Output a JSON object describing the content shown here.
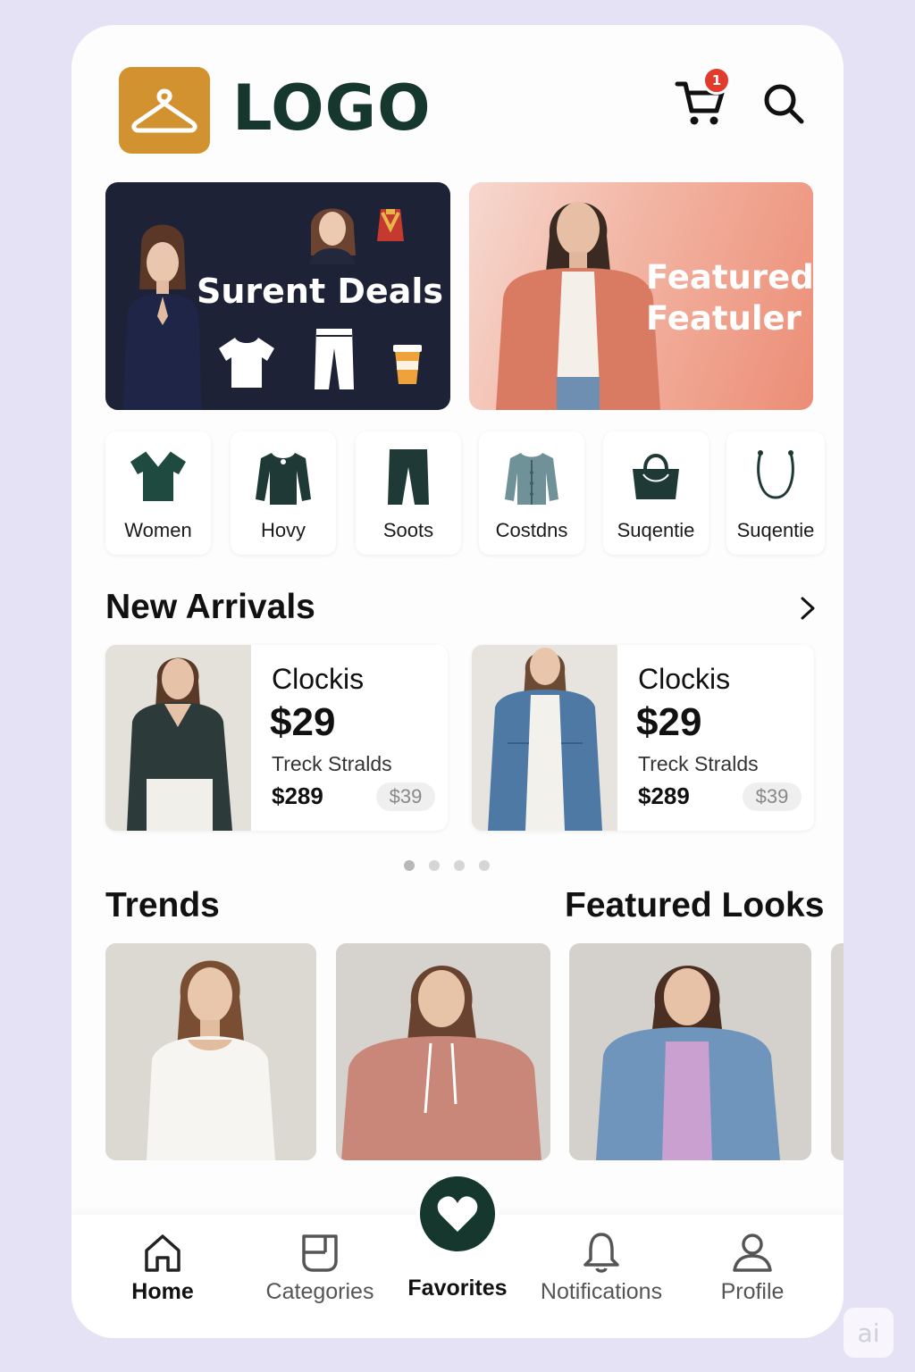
{
  "header": {
    "logo_text": "LOGO",
    "cart_badge": "1"
  },
  "banners": {
    "deals_title": "Surent Deals",
    "featured_title_line1": "Featured",
    "featured_title_line2": "Featuler"
  },
  "categories": [
    {
      "label": "Women",
      "icon": "tshirt-icon"
    },
    {
      "label": "Hovy",
      "icon": "longsleeve-icon"
    },
    {
      "label": "Soots",
      "icon": "pants-icon"
    },
    {
      "label": "Costdns",
      "icon": "jacket-icon"
    },
    {
      "label": "Suqentie",
      "icon": "handbag-icon"
    },
    {
      "label": "Suqentie",
      "icon": "necklace-icon"
    }
  ],
  "new_arrivals": {
    "title": "New Arrivals",
    "products": [
      {
        "name": "Clockis",
        "price": "$29",
        "brand": "Treck Stralds",
        "old_price": "$289",
        "tag": "$39"
      },
      {
        "name": "Clockis",
        "price": "$29",
        "brand": "Treck Stralds",
        "old_price": "$289",
        "tag": "$39"
      }
    ],
    "carousel_pages": 4,
    "active_page": 1
  },
  "trends": {
    "title": "Trends"
  },
  "featured_looks": {
    "title": "Featured Looks"
  },
  "bottom_nav": {
    "home": "Home",
    "categories": "Categories",
    "favorites": "Favorites",
    "notifications": "Notifications",
    "profile": "Profile"
  },
  "watermark": "ai",
  "colors": {
    "brand_dark_green": "#15372e",
    "logo_orange": "#d2922f",
    "badge_red": "#e23b2e",
    "deals_bg": "#1e2236",
    "featured_bg": "#ec8d76"
  }
}
